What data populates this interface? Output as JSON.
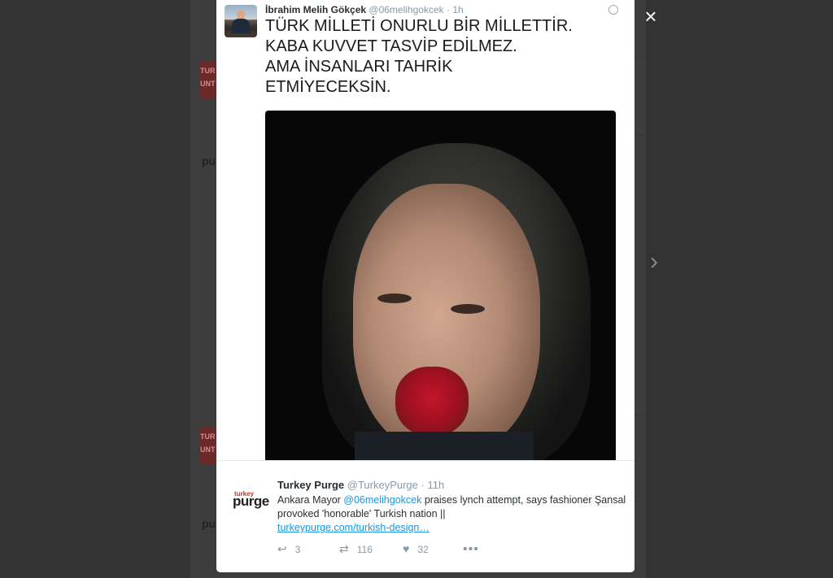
{
  "background": {
    "timeline_badge_text": "TUR",
    "timeline_badge_text2": "UNT",
    "timeline_logo_text": "purge"
  },
  "modal": {
    "close_icon": "×",
    "next_icon": "›",
    "media_tweet": {
      "author_name": "İbrahim Melih Gökçek",
      "handle": "@06melihgokcek",
      "separator": "·",
      "time": "1h",
      "text": "TÜRK MİLLETİ ONURLU BİR MİLLETTİR.\nKABA KUVVET TASVİP EDİLMEZ.\nAMA İNSANLARI TAHRİK\nETMİYECEKSİN."
    },
    "original_tweet": {
      "logo_top": "turkey",
      "logo_main": "purge",
      "author_name": "Turkey Purge",
      "handle": "@TurkeyPurge",
      "separator": "·",
      "time": "11h",
      "text_prefix": "Ankara Mayor ",
      "mention": "@06melihgokcek",
      "text_suffix": " praises lynch attempt, says fashioner Şansal provoked 'honorable' Turkish nation ||",
      "link": "turkeypurge.com/turkish-design…",
      "reply_count": "3",
      "retweet_count": "116",
      "like_count": "32"
    }
  }
}
